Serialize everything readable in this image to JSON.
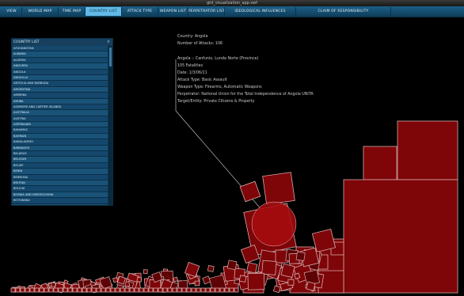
{
  "window": {
    "title": "gtd_visualization_app.swf"
  },
  "nav": {
    "tabs": [
      {
        "label": "VIEW",
        "active": false
      },
      {
        "label": "WORLD MAP",
        "active": false
      },
      {
        "label": "TIME MAP",
        "active": false
      },
      {
        "label": "COUNTRY LIST",
        "active": true
      },
      {
        "label": "ATTACK TYPE",
        "active": false
      },
      {
        "label": "WEAPON LIST",
        "active": false
      },
      {
        "label": "PERPETRATOR LIST",
        "active": false
      },
      {
        "label": "IDEOLOGICAL INFLUENCES",
        "active": false
      },
      {
        "label": "CLAIM OF RESPONSIBILITY",
        "active": false
      }
    ],
    "colors": {
      "bar": "#1c5f87",
      "active_tab": "#62b9e6"
    }
  },
  "country_panel": {
    "header": "COUNTRY LIST",
    "close_icon": "close-icon",
    "items": [
      "AFGHANISTAN",
      "ALBANIA",
      "ALGERIA",
      "ANDORRA",
      "ANGOLA",
      "ANGUILLA",
      "ANTIGUA AND BARBUDA",
      "ARGENTINA",
      "ARMENIA",
      "ARUBA",
      "ASHMORE AND CARTIER ISLANDS",
      "AUSTRALIA",
      "AUSTRIA",
      "AZERBAIJAN",
      "BAHAMAS",
      "BAHRAIN",
      "BANGLADESH",
      "BARBADOS",
      "BELARUS",
      "BELGIUM",
      "BELIZE",
      "BENIN",
      "BERMUDA",
      "BHUTAN",
      "BOLIVIA",
      "BOSNIA AND HERZEGOVINA",
      "BOTSWANA",
      "BOUVET ISLAND",
      "BRAZIL"
    ]
  },
  "info": {
    "country_line": "Country: Angola",
    "attacks_line": "Number of Attacks: 106",
    "location_line": "Angola :: Canfunio, Lunda Norte (Province)",
    "fatalities_line": "105 Fatalities",
    "date_line": "Date: 1/3/06/21",
    "attack_type_line": "Attack Type: Basic Assault",
    "weapon_line": "Weapon Type: Firearms, Automatic Weapons",
    "perpetrator_line": "Perpetrator: National Union for the Total Independence of Angola UNITA",
    "target_line": "Target/Entity: Private Citizens & Property"
  },
  "visualization": {
    "square_color": "#7e0508",
    "highlight_color": "#a80d0f",
    "line_color": "#bbbbbb"
  }
}
